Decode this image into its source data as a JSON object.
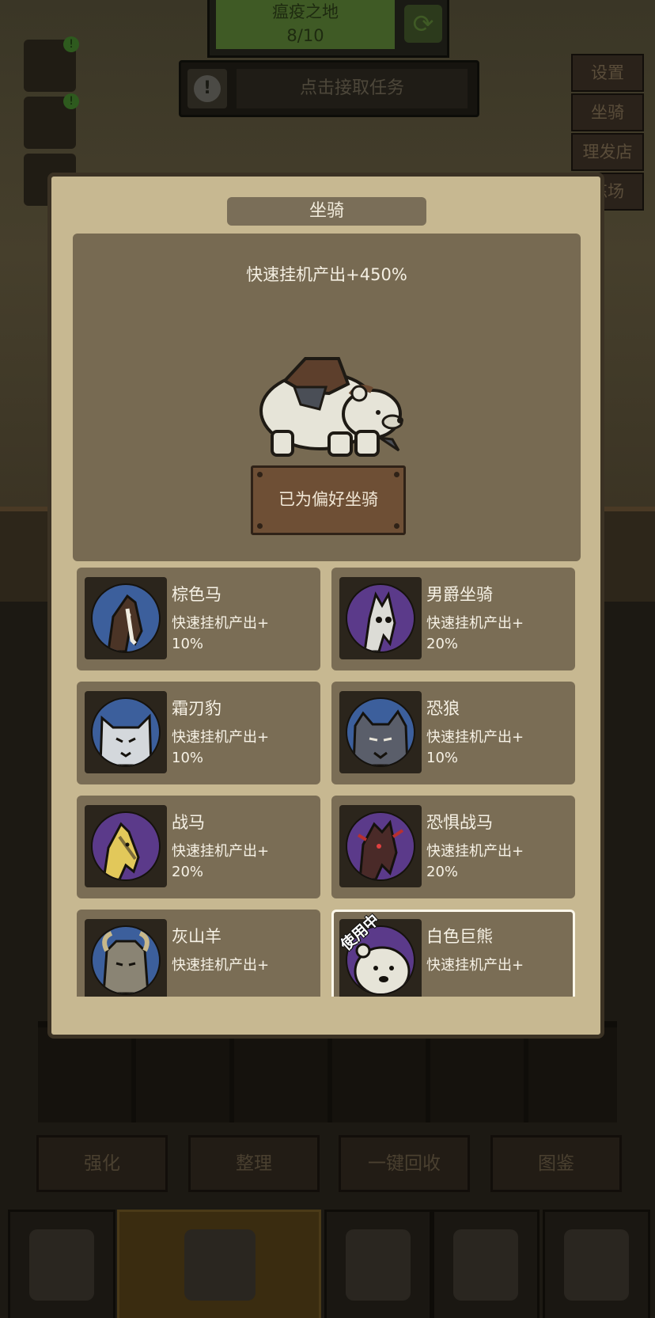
{
  "stage": {
    "name": "瘟疫之地",
    "progress": "8/10"
  },
  "task": {
    "label": "点击接取任务"
  },
  "side_menu": [
    "设置",
    "坐骑",
    "理发店",
    "练场"
  ],
  "actions": [
    "强化",
    "整理",
    "一键回收",
    "图鉴"
  ],
  "modal": {
    "title": "坐骑",
    "current_bonus": "快速挂机产出+450%",
    "favorite_label": "已为偏好坐骑",
    "mounts": [
      {
        "name": "棕色马",
        "bonus_prefix": "快速挂机产出+",
        "bonus_value": "10%",
        "ring": "#3c5f9c",
        "animal": "horse"
      },
      {
        "name": "男爵坐骑",
        "bonus_prefix": "快速挂机产出+",
        "bonus_value": "20%",
        "ring": "#5b3a8a",
        "animal": "ghost-horse"
      },
      {
        "name": "霜刃豹",
        "bonus_prefix": "快速挂机产出+",
        "bonus_value": "10%",
        "ring": "#3c5f9c",
        "animal": "cat"
      },
      {
        "name": "恐狼",
        "bonus_prefix": "快速挂机产出+",
        "bonus_value": "10%",
        "ring": "#3c5f9c",
        "animal": "wolf"
      },
      {
        "name": "战马",
        "bonus_prefix": "快速挂机产出+",
        "bonus_value": "20%",
        "ring": "#5b3a8a",
        "animal": "warhorse"
      },
      {
        "name": "恐惧战马",
        "bonus_prefix": "快速挂机产出+",
        "bonus_value": "20%",
        "ring": "#5b3a8a",
        "animal": "dread-horse"
      },
      {
        "name": "灰山羊",
        "bonus_prefix": "快速挂机产出+",
        "bonus_value": "",
        "ring": "#3c5f9c",
        "animal": "goat"
      },
      {
        "name": "白色巨熊",
        "bonus_prefix": "快速挂机产出+",
        "bonus_value": "",
        "ring": "#5b3a8a",
        "animal": "bear",
        "in_use": "使用中"
      }
    ]
  }
}
